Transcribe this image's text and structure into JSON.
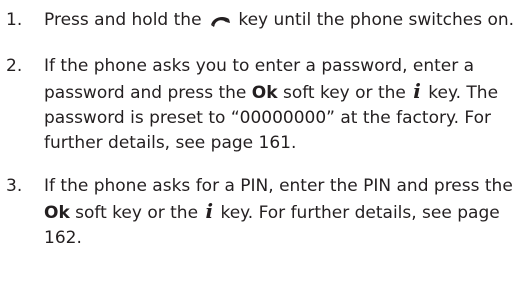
{
  "steps": [
    {
      "number": "1.",
      "text_a": "Press and hold the",
      "text_b": "key until the phone switches on."
    },
    {
      "number": "2.",
      "text_a": "If the phone asks you to enter a password, enter a password and press the",
      "bold": "Ok",
      "text_b": "soft key or the",
      "info_key": "i",
      "text_c": "key. The password is preset to “00000000” at the factory. For further details, see page 161."
    },
    {
      "number": "3.",
      "text_a": "If the phone asks for a PIN, enter the PIN and press the",
      "bold": "Ok",
      "text_b": "soft key or the",
      "info_key": "i",
      "text_c": "key. For further details, see page 162."
    }
  ],
  "icons": {
    "power_key": "power-end-key-icon"
  }
}
